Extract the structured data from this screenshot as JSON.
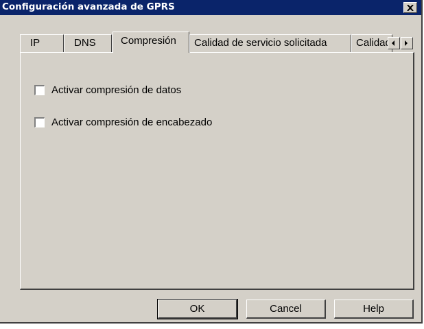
{
  "window": {
    "title": "Configuración avanzada de GPRS"
  },
  "tabs": [
    {
      "label": "IP",
      "active": false
    },
    {
      "label": "DNS",
      "active": false
    },
    {
      "label": "Compresión",
      "active": true
    },
    {
      "label": "Calidad de servicio solicitada",
      "active": false
    },
    {
      "label": "Calidad de servicio mínima",
      "active": false
    }
  ],
  "tab_scroll": {
    "left_icon": "arrow-left-icon",
    "right_icon": "arrow-right-icon"
  },
  "compression": {
    "data_compression": {
      "label": "Activar compresión de datos",
      "checked": false
    },
    "header_compression": {
      "label": "Activar compresión de encabezado",
      "checked": false
    }
  },
  "buttons": {
    "ok": "OK",
    "cancel": "Cancel",
    "help": "Help"
  },
  "colors": {
    "title_bar": "#0a246a",
    "face": "#d4d0c8"
  }
}
